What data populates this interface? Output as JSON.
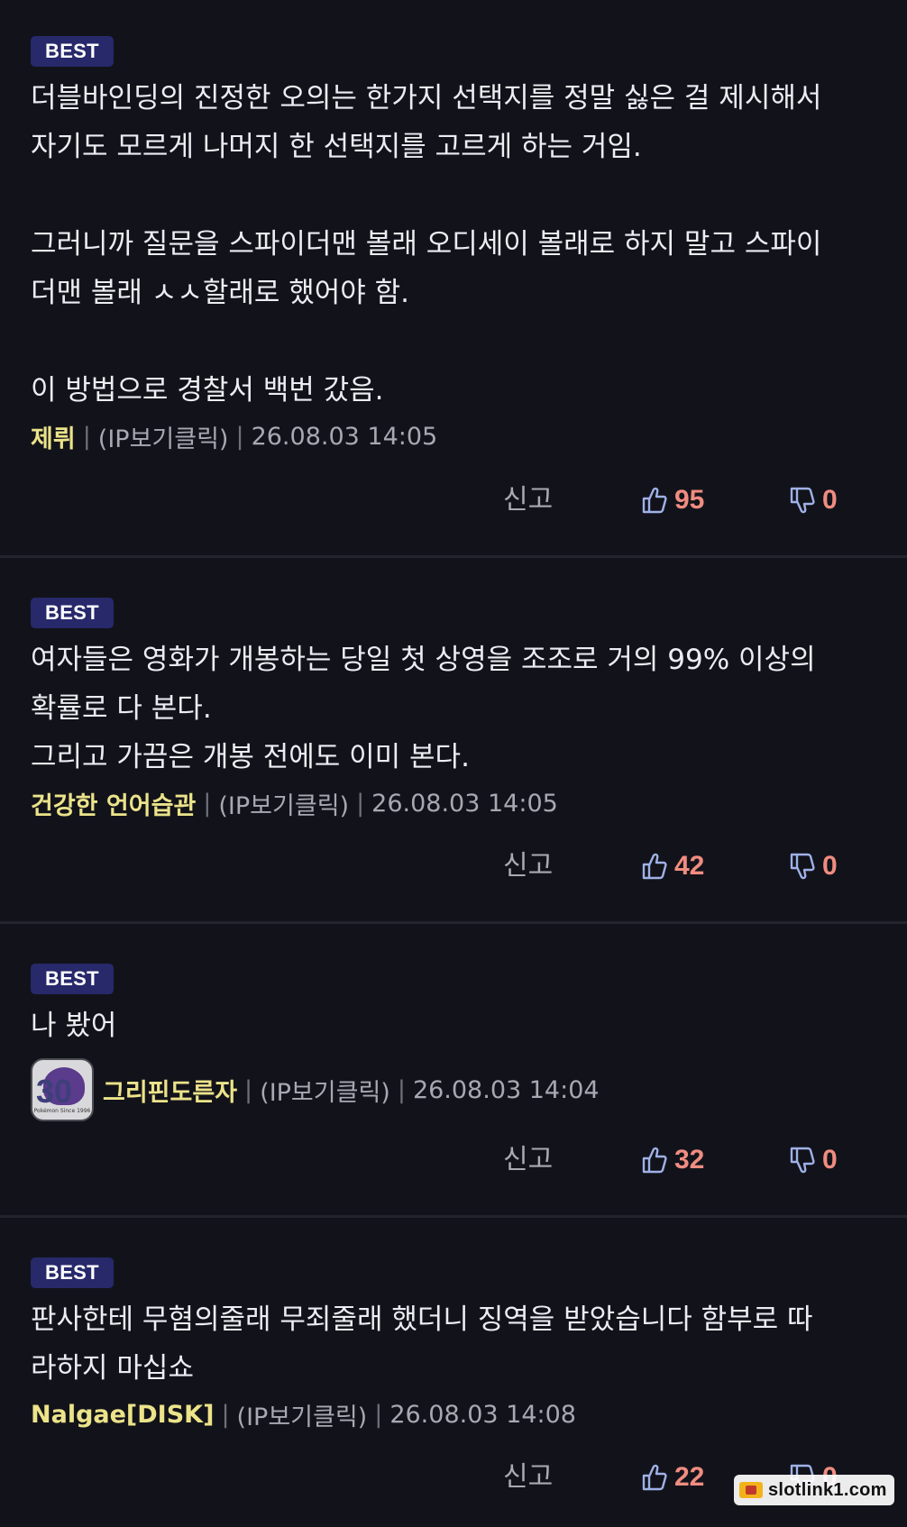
{
  "comments": [
    {
      "badge": "BEST",
      "text": "더블바인딩의 진정한 오의는 한가지 선택지를 정말 싫은 걸 제시해서\n자기도 모르게 나머지 한 선택지를 고르게 하는 거임.\n\n그러니까 질문을 스파이더맨 볼래 오디세이 볼래로 하지 말고 스파이\n더맨 볼래 ㅅㅅ할래로 했어야 함.\n\n이 방법으로 경찰서 백번 갔음.",
      "author": "제뤼",
      "ip": "(IP보기클릭)",
      "timestamp": "26.08.03 14:05",
      "report": "신고",
      "likes": "95",
      "dislikes": "0"
    },
    {
      "badge": "BEST",
      "text": "여자들은 영화가 개봉하는 당일 첫 상영을 조조로 거의 99% 이상의\n확률로 다 본다.\n그리고 가끔은 개봉 전에도 이미 본다.",
      "author": "건강한 언어습관",
      "ip": "(IP보기클릭)",
      "timestamp": "26.08.03 14:05",
      "report": "신고",
      "likes": "42",
      "dislikes": "0"
    },
    {
      "badge": "BEST",
      "text": "나 봤어",
      "author": "그리핀도른자",
      "ip": "(IP보기클릭)",
      "timestamp": "26.08.03 14:04",
      "report": "신고",
      "likes": "32",
      "dislikes": "0",
      "avatar": {
        "num": "30",
        "caption": "Pokémon Since 1996"
      }
    },
    {
      "badge": "BEST",
      "text": "판사한테 무혐의줄래 무죄줄래 했더니 징역을 받았습니다 함부로 따\n라하지 마십쇼",
      "author": "Nalgae[DISK]",
      "ip": "(IP보기클릭)",
      "timestamp": "26.08.03 14:08",
      "report": "신고",
      "likes": "22",
      "dislikes": "0"
    }
  ],
  "separator": "|",
  "icons": {
    "like": "thumbs-up-icon",
    "dislike": "thumbs-down-icon"
  },
  "colors": {
    "background": "#12131a",
    "badge": "#27296b",
    "author": "#ece38a",
    "count": "#f08c80"
  },
  "watermark": "slotlink1.com"
}
